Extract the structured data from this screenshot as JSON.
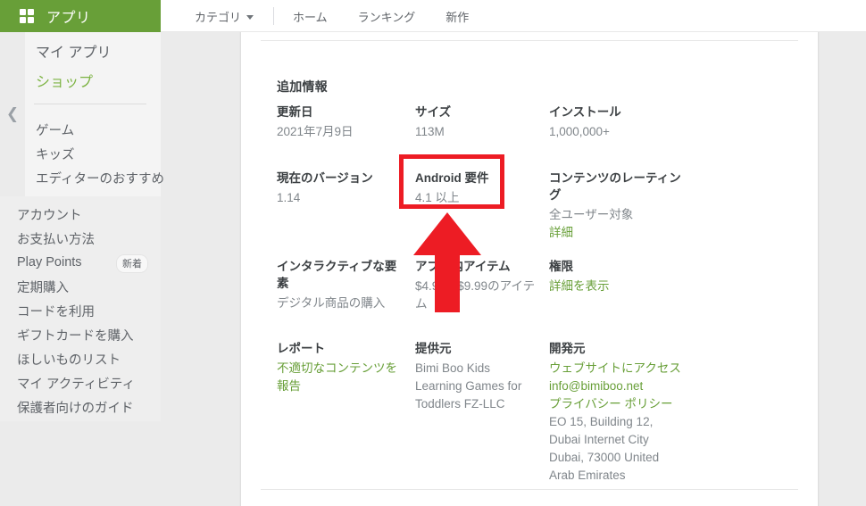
{
  "brand": {
    "title": "アプリ",
    "icon": "grid-apps-icon",
    "color": "#689f38"
  },
  "topnav": {
    "category_label": "カテゴリ",
    "category_icon": "chevron-down-icon",
    "links": [
      "ホーム",
      "ランキング",
      "新作"
    ]
  },
  "sidebar": {
    "collapse_icon": "chevron-left-icon",
    "primary": [
      {
        "label": "マイ アプリ",
        "active": false
      },
      {
        "label": "ショップ",
        "active": true
      }
    ],
    "secondary": [
      {
        "label": "ゲーム"
      },
      {
        "label": "キッズ"
      },
      {
        "label": "エディターのおすすめ"
      }
    ],
    "account": [
      {
        "label": "アカウント",
        "badge": ""
      },
      {
        "label": "お支払い方法",
        "badge": ""
      },
      {
        "label": "Play Points",
        "badge": "新着"
      },
      {
        "label": "定期購入",
        "badge": ""
      },
      {
        "label": "コードを利用",
        "badge": ""
      },
      {
        "label": "ギフトカードを購入",
        "badge": ""
      },
      {
        "label": "ほしいものリスト",
        "badge": ""
      },
      {
        "label": "マイ アクティビティ",
        "badge": ""
      },
      {
        "label": "保護者向けのガイド",
        "badge": ""
      }
    ]
  },
  "main": {
    "section_title": "追加情報",
    "row1": {
      "updated_label": "更新日",
      "updated_value": "2021年7月9日",
      "size_label": "サイズ",
      "size_value": "113M",
      "installs_label": "インストール",
      "installs_value": "1,000,000+"
    },
    "row2": {
      "version_label": "現在のバージョン",
      "version_value": "1.14",
      "android_label": "Android 要件",
      "android_value": "4.1 以上",
      "rating_label": "コンテンツのレーティング",
      "rating_value": "全ユーザー対象",
      "rating_link": "詳細"
    },
    "row3": {
      "interactive_label": "インタラクティブな要素",
      "interactive_value": "デジタル商品の購入",
      "inapp_label": "アプリ内アイテム",
      "inapp_value": "$4.99～$9.99のアイテム",
      "permissions_label": "権限",
      "permissions_link": "詳細を表示"
    },
    "row4": {
      "report_label": "レポート",
      "report_link": "不適切なコンテンツを報告",
      "offered_label": "提供元",
      "offered_value": "Bimi Boo Kids Learning Games for Toddlers FZ-LLC",
      "developer_label": "開発元",
      "developer_website": "ウェブサイトにアクセス",
      "developer_email": "info@bimiboo.net",
      "developer_privacy": "プライバシー ポリシー",
      "developer_address": "EO 15, Building 12, Dubai Internet City Dubai, 73000 United Arab Emirates"
    }
  },
  "annotations": {
    "highlight_target": "Android 要件",
    "box_color": "#ed1c24",
    "arrow_color": "#ed1c24",
    "arrow_direction": "up"
  }
}
